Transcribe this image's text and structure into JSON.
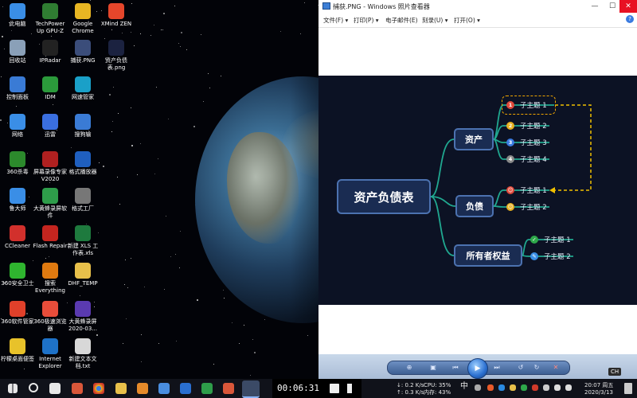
{
  "desktop": {
    "icons": [
      {
        "label": "此电脑",
        "icon": "computer-icon",
        "color": "#3a8ee6"
      },
      {
        "label": "TechPower Up GPU-Z",
        "icon": "gpu-z-icon",
        "color": "#2f7d32"
      },
      {
        "label": "Google Chrome",
        "icon": "chrome-icon",
        "color": "#e8b623"
      },
      {
        "label": "XMind ZEN",
        "icon": "xmind-icon",
        "color": "#e5462b"
      },
      {
        "label": "回收站",
        "icon": "recycle-bin-icon",
        "color": "#8aa0b8"
      },
      {
        "label": "IPRadar",
        "icon": "ipradar-icon",
        "color": "#222222"
      },
      {
        "label": "捕获.PNG",
        "icon": "png-file-icon",
        "color": "#3b4d7a"
      },
      {
        "label": "资产负债表.png",
        "icon": "png-file-icon",
        "color": "#1b2240"
      },
      {
        "label": "控制面板",
        "icon": "control-panel-icon",
        "color": "#3a7bd5"
      },
      {
        "label": "IDM",
        "icon": "idm-icon",
        "color": "#2b9a3b"
      },
      {
        "label": "网速管家",
        "icon": "netspeed-icon",
        "color": "#1aa0c8"
      },
      {
        "label": "网络",
        "icon": "network-icon",
        "color": "#3a8ee6"
      },
      {
        "label": "迅雷",
        "icon": "thunder-icon",
        "color": "#3a6fe0"
      },
      {
        "label": "搜狗输",
        "icon": "sogou-icon",
        "color": "#3a7bd5"
      },
      {
        "label": "360杀毒",
        "icon": "360-antivirus-icon",
        "color": "#2c8a2c"
      },
      {
        "label": "屏幕录像专家V2020",
        "icon": "screen-recorder-icon",
        "color": "#b02020"
      },
      {
        "label": "格式播放器",
        "icon": "player-icon",
        "color": "#1f5fbf"
      },
      {
        "label": "鲁大师",
        "icon": "ludashi-icon",
        "color": "#3a8ee6"
      },
      {
        "label": "大黄蜂录屏软件",
        "icon": "bee-recorder-icon",
        "color": "#2e9d4a"
      },
      {
        "label": "格式工厂",
        "icon": "format-factory-icon",
        "color": "#777777"
      },
      {
        "label": "CCleaner",
        "icon": "ccleaner-icon",
        "color": "#d2302c"
      },
      {
        "label": "Flash Repair",
        "icon": "flash-icon",
        "color": "#c4251f"
      },
      {
        "label": "新建 XLS 工作表.xls",
        "icon": "xls-file-icon",
        "color": "#1e7a3e"
      },
      {
        "label": "360安全卫士",
        "icon": "360-security-icon",
        "color": "#2fb52f"
      },
      {
        "label": "搜索Everything",
        "icon": "search-everything-icon",
        "color": "#e07a10"
      },
      {
        "label": "DHF_TEMP",
        "icon": "folder-icon",
        "color": "#e8c04a"
      },
      {
        "label": "360软件管家",
        "icon": "360-software-icon",
        "color": "#e0402a"
      },
      {
        "label": "360极速浏览器",
        "icon": "360-browser-icon",
        "color": "#e84d3a"
      },
      {
        "label": "大黄蜂录屏2020-03...",
        "icon": "video-file-icon",
        "color": "#5a3ab0"
      },
      {
        "label": "柠檬桌面便签",
        "icon": "sticky-note-icon",
        "color": "#e8c22a"
      },
      {
        "label": "Internet Explorer",
        "icon": "ie-icon",
        "color": "#1e72c8"
      },
      {
        "label": "新建文本文档.txt",
        "icon": "txt-file-icon",
        "color": "#d8d8d8"
      }
    ]
  },
  "viewer": {
    "title": "捕获.PNG - Windows 照片查看器",
    "menus": [
      "文件(F) ▾",
      "打印(P) ▾",
      "电子邮件(E)",
      "刻录(U) ▾",
      "打开(O) ▾"
    ],
    "controls": {
      "minimize": "—",
      "maximize": "☐",
      "close": "✕",
      "help_icon": "?"
    }
  },
  "mindmap": {
    "central": "资产负债表",
    "branches": [
      {
        "label": "资产",
        "subs": [
          {
            "n": "1",
            "label": "子主题 1",
            "color": "#e04a3a"
          },
          {
            "n": "2",
            "label": "子主题 2",
            "color": "#e8b020"
          },
          {
            "n": "3",
            "label": "子主题 3",
            "color": "#3a7be0"
          },
          {
            "n": "4",
            "label": "子主题 4",
            "color": "#8a8a8a"
          }
        ]
      },
      {
        "label": "负债",
        "subs": [
          {
            "n": "☺",
            "label": "子主题 1",
            "color": "#e04a3a"
          },
          {
            "n": "☺",
            "label": "子主题 2",
            "color": "#e8b020"
          }
        ]
      },
      {
        "label": "所有者权益",
        "subs": [
          {
            "n": "✓",
            "label": "子主题 1",
            "color": "#2ea84a"
          },
          {
            "n": "✎",
            "label": "子主题 2",
            "color": "#3a8ee6"
          }
        ]
      }
    ]
  },
  "recorder": {
    "time": "00:06:31"
  },
  "tray": {
    "net_up": "↓: 0.2 K/s",
    "net_down": "↑: 0.3 K/s",
    "cpu": "CPU: 35%",
    "mem": "内存: 43%",
    "ime": "中",
    "ime_overlay": "CH",
    "time": "20:07 周五",
    "date": "2020/3/13"
  }
}
